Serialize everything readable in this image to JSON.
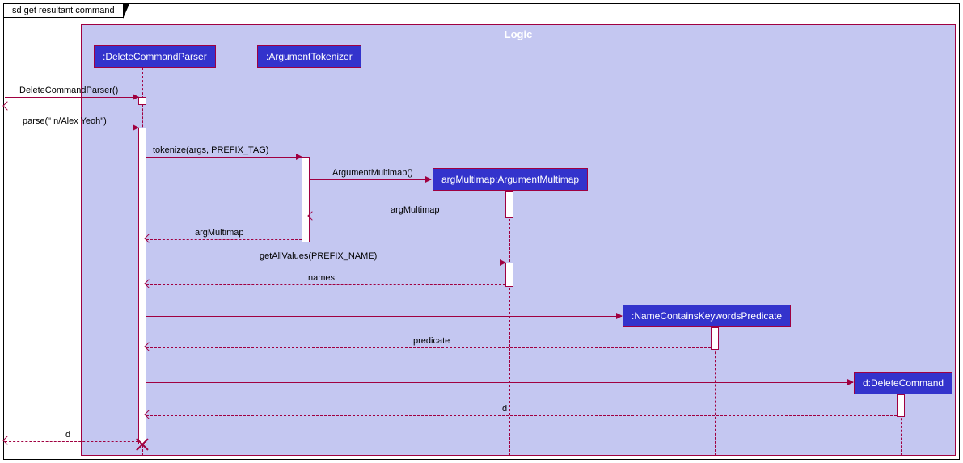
{
  "frame_title": "sd get resultant command",
  "logic_title": "Logic",
  "participants": {
    "dcp": ":DeleteCommandParser",
    "at": ":ArgumentTokenizer",
    "am": "argMultimap:ArgumentMultimap",
    "nckp": ":NameContainsKeywordsPredicate",
    "dc": "d:DeleteCommand"
  },
  "messages": {
    "m1": "DeleteCommandParser()",
    "m2": "parse(\" n/Alex Yeoh\")",
    "m3": "tokenize(args, PREFIX_TAG)",
    "m4": "ArgumentMultimap()",
    "m5": "argMultimap",
    "m6": "argMultimap",
    "m7": "getAllValues(PREFIX_NAME)",
    "m8": "names",
    "m9": "predicate",
    "m10": "d",
    "m11": "d"
  }
}
